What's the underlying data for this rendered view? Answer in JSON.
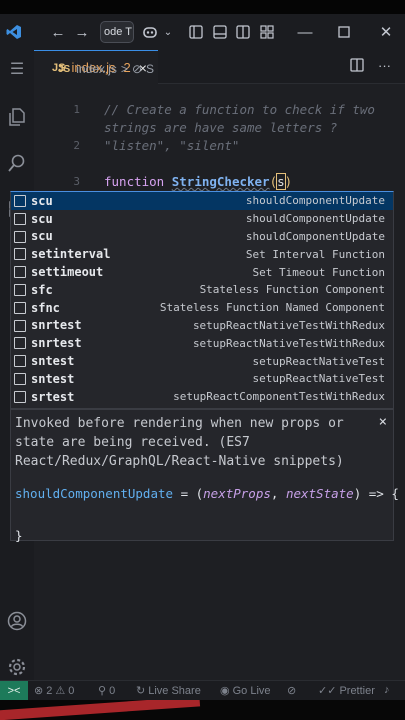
{
  "titlebar": {
    "search_text": "ode T",
    "icons": [
      "vscode-logo-icon",
      "back-arrow-icon",
      "forward-arrow-icon",
      "copilot-icon",
      "chevron-down-icon",
      "toggle-sidebar-icon",
      "toggle-panel-icon",
      "toggle-secondary-sidebar-icon",
      "customize-layout-icon",
      "minimize-icon",
      "maximize-icon",
      "close-icon"
    ]
  },
  "tab": {
    "badge": "JS",
    "name": "index.js",
    "problems": "2",
    "close": "×"
  },
  "breadcrumb": {
    "badge": "JS",
    "file": "index.js",
    "separator": ">",
    "symbol": "S"
  },
  "editor": {
    "lines": [
      {
        "number": "1",
        "text": "// Create a function to check if two"
      },
      {
        "number": "",
        "text": "strings are have same letters ?"
      },
      {
        "number": "2",
        "text": "\"listen\", \"silent\""
      },
      {
        "number": "3",
        "keyword": "function",
        "name": "StringChecker",
        "open": "(",
        "typed": "s",
        "close": ")"
      }
    ]
  },
  "suggestions": [
    {
      "label": "scu",
      "detail": "shouldComponentUpdate"
    },
    {
      "label": "scu",
      "detail": "shouldComponentUpdate"
    },
    {
      "label": "scu",
      "detail": "shouldComponentUpdate"
    },
    {
      "label": "setinterval",
      "detail": "Set Interval Function"
    },
    {
      "label": "settimeout",
      "detail": "Set Timeout Function"
    },
    {
      "label": "sfc",
      "detail": "Stateless Function Component"
    },
    {
      "label": "sfnc",
      "detail": "Stateless Function Named Component"
    },
    {
      "label": "snrtest",
      "detail": "setupReactNativeTestWithRedux"
    },
    {
      "label": "snrtest",
      "detail": "setupReactNativeTestWithRedux"
    },
    {
      "label": "sntest",
      "detail": "setupReactNativeTest"
    },
    {
      "label": "sntest",
      "detail": "setupReactNativeTest"
    },
    {
      "label": "srtest",
      "detail": "setupReactComponentTestWithRedux"
    }
  ],
  "doc": {
    "description": "Invoked before rendering when new props or state are being received. (ES7 React/Redux/GraphQL/React-Native snippets)",
    "close": "×",
    "code_fn": "shouldComponentUpdate",
    "code_eq": " = (",
    "code_arg1": "nextProps",
    "code_comma": ", ",
    "code_arg2": "nextState",
    "code_end": ") => {",
    "code_close": "}"
  },
  "statusbar": {
    "remote": "><",
    "errors": "2",
    "warnings": "0",
    "ports": "0",
    "live_share": "Live Share",
    "go_live": "Go Live",
    "prettier": "Prettier"
  },
  "colors": {
    "accent": "#3a8ee6",
    "selected": "#043663",
    "remote": "#1d7a5a"
  }
}
